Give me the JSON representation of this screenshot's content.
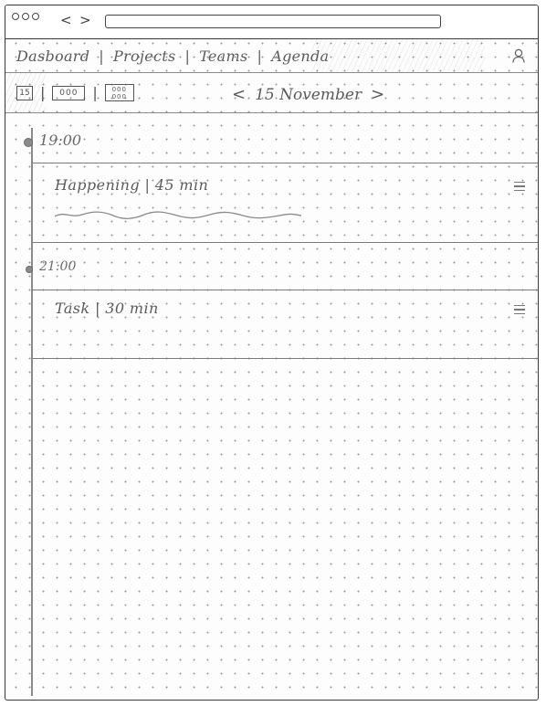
{
  "window": {
    "back_arrow": "<",
    "forward_arrow": ">",
    "address": ""
  },
  "nav": {
    "items": [
      "Dasboard",
      "Projects",
      "Teams",
      "Agenda"
    ],
    "separator": "|",
    "user_icon": "user-icon"
  },
  "toolbar": {
    "view_day": "15",
    "view_week": "000",
    "view_month": "000 000",
    "view_separator": "|",
    "prev": "<",
    "date": "15 November",
    "next": ">"
  },
  "timeline": {
    "slots": [
      {
        "time": "19:00",
        "event_title": "Happening | 45 min"
      },
      {
        "time": "21:00",
        "event_title": "Task | 30 min"
      }
    ]
  },
  "colors": {
    "ink": "#4a4a4a",
    "pencil": "#8a8a8a",
    "paper": "#fdfdfd"
  }
}
